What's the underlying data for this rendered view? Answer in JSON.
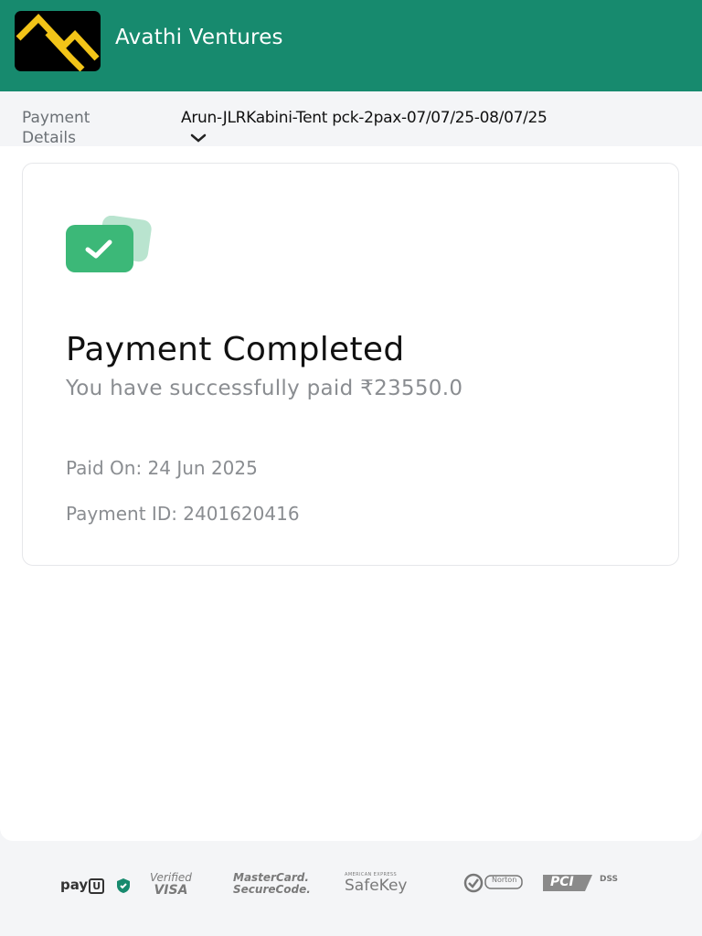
{
  "header": {
    "brand": "Avathi Ventures"
  },
  "payment_bar": {
    "label": "Payment Details",
    "selected": "Arun-JLRKabini-Tent pck-2pax-07/07/25-08/07/25"
  },
  "receipt": {
    "title": "Payment Completed",
    "amount_text": "You have successfully paid ₹23550.0",
    "paid_on": "Paid On: 24 Jun 2025",
    "payment_id": "Payment ID: 2401620416"
  },
  "footer": {
    "payu": "pay",
    "visa_top": "Verified",
    "visa_bottom": "VISA",
    "mc_top": "MasterCard.",
    "mc_bottom": "SecureCode.",
    "amex_top": "AMERICAN EXPRESS",
    "amex_bottom": "SafeKey",
    "norton": "Norton",
    "pci": "PCI",
    "dss": "DSS"
  },
  "colors": {
    "brand": "#178a6e",
    "success": "#3cb878"
  }
}
